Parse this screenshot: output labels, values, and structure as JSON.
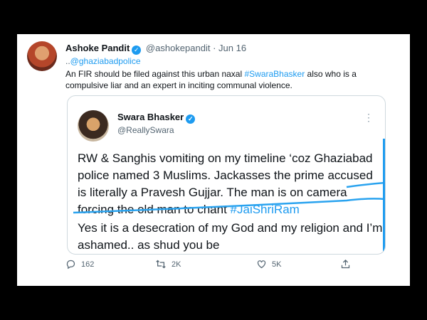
{
  "tweet": {
    "author_name": "Ashoke Pandit",
    "author_handle": "@ashokepandit",
    "date": "· Jun 16",
    "reply_prefix": "..",
    "mention": "@ghaziabadpolice",
    "text_before": "An FIR should be filed against this urban naxal ",
    "hashtag": "#SwaraBhasker",
    "text_after": " also who is a compulsive liar and an expert in inciting communal violence."
  },
  "quoted": {
    "name": "Swara Bhasker",
    "handle": "@ReallySwara",
    "more": "⋮",
    "para1": "RW & Sanghis vomiting on my timeline ‘coz Ghaziabad police named 3 Muslims. Jackasses the prime accused is literally a Pravesh Gujjar. The man is on camera forcing the old man to chant ",
    "hashtag": "#JaiShriRam",
    "para2": "Yes it is a desecration of my God and my religion and I’m ashamed.. as shud you be"
  },
  "actions": {
    "replies": "162",
    "retweets": "2K",
    "likes": "5K"
  },
  "colors": {
    "accent": "#1d9bf0",
    "text": "#0f1419",
    "muted": "#536471"
  }
}
